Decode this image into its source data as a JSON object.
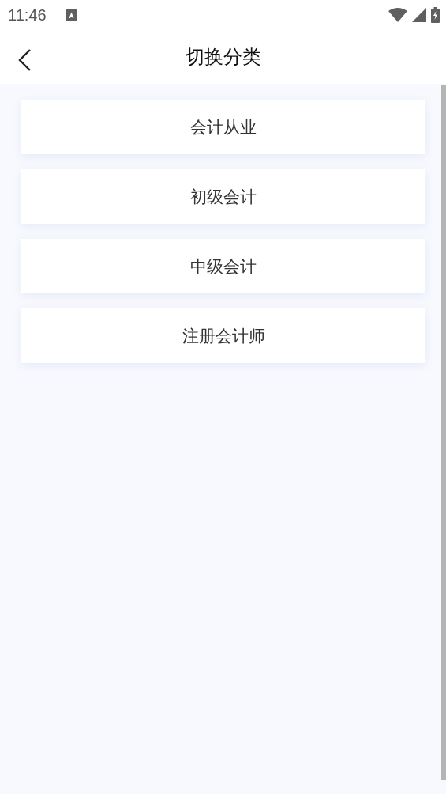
{
  "status_bar": {
    "time": "11:46"
  },
  "header": {
    "title": "切换分类"
  },
  "categories": [
    {
      "label": "会计从业"
    },
    {
      "label": "初级会计"
    },
    {
      "label": "中级会计"
    },
    {
      "label": "注册会计师"
    }
  ]
}
